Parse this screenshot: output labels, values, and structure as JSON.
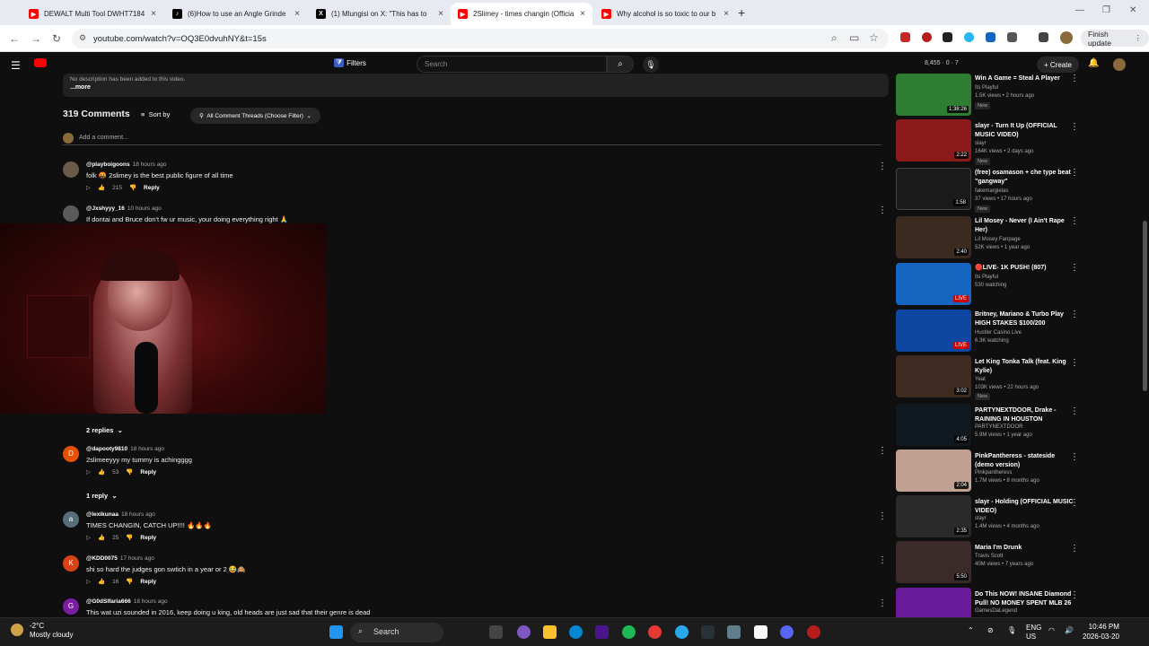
{
  "browser": {
    "tabs": [
      {
        "title": "DEWALT Multi Tool DWHT7184",
        "icon": "youtube-icon",
        "color": "#ff0000"
      },
      {
        "title": "(6)How to use an Angle Grinde",
        "icon": "tiktok-icon",
        "color": "#000000"
      },
      {
        "title": "(1) Mlungisi on X: \"This has to",
        "icon": "x-icon",
        "color": "#000000"
      },
      {
        "title": "2Slimey - times changin (Officia",
        "icon": "youtube-icon",
        "color": "#ff0000"
      },
      {
        "title": "Why alcohol is so toxic to our b",
        "icon": "youtube-icon",
        "color": "#ff0000"
      }
    ],
    "url": "youtube.com/watch?v=OQ3E0dvuhNY&t=15s",
    "finish_update": "Finish update"
  },
  "youtube": {
    "filters": "Filters",
    "search_placeholder": "Search",
    "stats": "8,455 · 0 · 7",
    "create": "Create",
    "description": "No description has been added to this video.",
    "more": "...more",
    "comments_count": "319 Comments",
    "sort_by": "Sort by",
    "filter_pill": "All Comment Threads (Choose Filter)",
    "add_comment": "Add a comment...",
    "comments": [
      {
        "user": "@playboigoons",
        "time": "18 hours ago",
        "text": "folk 🤬 2slimey is the best public figure of all time",
        "likes": "215",
        "reply": "Reply",
        "avatar": "",
        "color": "#6a5a4a"
      },
      {
        "user": "@Jxshyyy_16",
        "time": "10 hours ago",
        "text": "If dontai and Bruce don't fw ur music, your doing everything right 🙏",
        "likes": "",
        "reply": "Reply",
        "avatar": "",
        "color": "#5a5a5a"
      },
      {
        "user": "@dapooty9810",
        "time": "18 hours ago",
        "text": "2slimeeyyy my tummy is achingggg",
        "likes": "53",
        "reply": "Reply",
        "avatar": "D",
        "color": "#e65100"
      },
      {
        "user": "@lexikunaa",
        "time": "18 hours ago",
        "text": "TIMES CHANGIN, CATCH UP!!!! 🔥🔥🔥",
        "likes": "25",
        "reply": "Reply",
        "avatar": "a",
        "color": "#546e7a"
      },
      {
        "user": "@KDD0075",
        "time": "17 hours ago",
        "text": "shi so hard the judges gon swtich in a year or 2 😂🙈",
        "likes": "16",
        "reply": "Reply",
        "avatar": "K",
        "color": "#d84315"
      },
      {
        "user": "@G0dSlfaria666",
        "time": "18 hours ago",
        "text": "This wat uzi sounded in 2016, keep doing u king, old heads are just sad that their genre is dead",
        "likes": "",
        "reply": "Reply",
        "avatar": "G",
        "color": "#7b1fa2"
      }
    ],
    "replies_2": "2 replies",
    "replies_1": "1 reply",
    "recommendations": [
      {
        "title": "Win A Game = Steal A Player",
        "channel": "Its Playful",
        "meta": "1.5K views • 2 hours ago",
        "badge": "New",
        "duration": "1:38:26",
        "color": "#2e7d32"
      },
      {
        "title": "slayr - Turn It Up (OFFICIAL MUSIC VIDEO)",
        "channel": "slayr",
        "meta": "164K views • 2 days ago",
        "badge": "New",
        "duration": "2:22",
        "color": "#8b1a1a"
      },
      {
        "title": "(free) osamason + che type beat \"gangway\"",
        "channel": "fakemargielas",
        "meta": "37 views • 17 hours ago",
        "badge": "New",
        "duration": "1:58",
        "color": "#1a1a1a"
      },
      {
        "title": "Lil Mosey - Never (I Ain't Rape Her)",
        "channel": "Lil Mosey Fanpage",
        "meta": "52K views • 1 year ago",
        "badge": "",
        "duration": "2:40",
        "color": "#3a2a20"
      },
      {
        "title": "🔴LIVE- 1K PUSH! (807)",
        "channel": "Its Playful",
        "meta": "530 watching",
        "badge": "",
        "duration": "LIVE",
        "color": "#1565c0"
      },
      {
        "title": "Britney, Mariano & Turbo Play HIGH STAKES $100/200",
        "channel": "Hustler Casino Live",
        "meta": "6.3K watching",
        "badge": "",
        "duration": "LIVE",
        "color": "#0d47a1"
      },
      {
        "title": "Let King Tonka Talk (feat. King Kylie)",
        "channel": "Yeat",
        "meta": "103K views • 22 hours ago",
        "badge": "New",
        "duration": "3:02",
        "color": "#3e2a20"
      },
      {
        "title": "PARTYNEXTDOOR, Drake - RAINING IN HOUSTON",
        "channel": "PARTYNEXTDOOR",
        "meta": "5.9M views • 1 year ago",
        "badge": "",
        "duration": "4:05",
        "color": "#101820"
      },
      {
        "title": "PinkPantheress - stateside (demo version)",
        "channel": "Pinkpantheress",
        "meta": "1.7M views • 8 months ago",
        "badge": "",
        "duration": "2:04",
        "color": "#c0a090"
      },
      {
        "title": "slayr - Holding (OFFICIAL MUSIC VIDEO)",
        "channel": "slayr",
        "meta": "1.4M views • 4 months ago",
        "badge": "",
        "duration": "2:35",
        "color": "#2a2a2a"
      },
      {
        "title": "Maria I'm Drunk",
        "channel": "Travis Scott",
        "meta": "40M views • 7 years ago",
        "badge": "",
        "duration": "5:50",
        "color": "#3a2a2a"
      },
      {
        "title": "Do This NOW! INSANE Diamond Pull! NO MONEY SPENT MLB 26",
        "channel": "GamesDaLegend",
        "meta": "",
        "badge": "",
        "duration": "",
        "color": "#6a1b9a"
      }
    ]
  },
  "taskbar": {
    "temp": "-2°C",
    "weather": "Mostly cloudy",
    "search": "Search",
    "lang": "ENG",
    "region": "US",
    "time": "10:46 PM",
    "date": "2026-03-20"
  }
}
